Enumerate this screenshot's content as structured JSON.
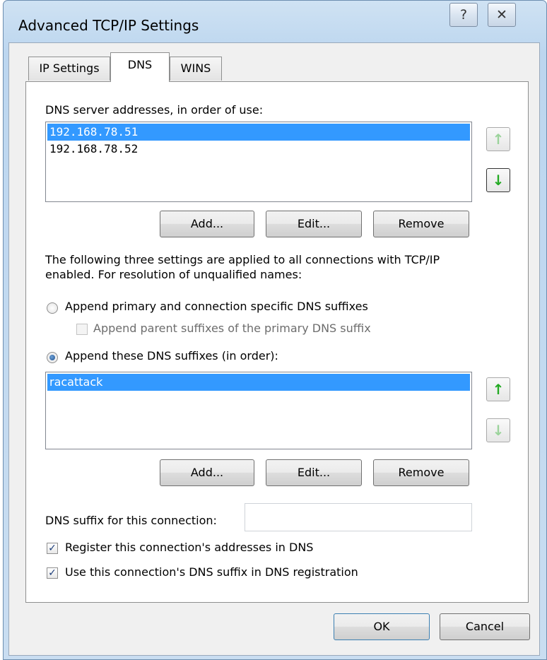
{
  "window": {
    "title": "Advanced TCP/IP Settings",
    "help_glyph": "?",
    "close_glyph": "✕"
  },
  "tabs": [
    "IP Settings",
    "DNS",
    "WINS"
  ],
  "dns": {
    "servers_label": "DNS server addresses, in order of use:",
    "servers": [
      "192.168.78.51",
      "192.168.78.52"
    ],
    "buttons": {
      "add": "Add...",
      "edit": "Edit...",
      "remove": "Remove"
    },
    "info_text_1": "The following three settings are applied to all connections with TCP/IP",
    "info_text_2": "enabled. For resolution of unqualified names:",
    "option_primary": "Append primary and connection specific DNS suffixes",
    "option_parent": "Append parent suffixes of the primary DNS suffix",
    "option_these": "Append these DNS suffixes (in order):",
    "suffixes": [
      "racattack"
    ],
    "suffix_buttons": {
      "add": "Add...",
      "edit": "Edit...",
      "remove": "Remove"
    },
    "connection_suffix_label": "DNS suffix for this connection:",
    "connection_suffix_value": "",
    "register_label": "Register this connection's addresses in DNS",
    "use_suffix_label": "Use this connection's DNS suffix in DNS registration",
    "arrows": {
      "up": "↑",
      "down": "↓"
    }
  },
  "footer": {
    "ok": "OK",
    "cancel": "Cancel"
  },
  "colors": {
    "selection": "#3399ff",
    "arrow_green": "#22aa22",
    "arrow_disabled": "#9bd39b"
  }
}
